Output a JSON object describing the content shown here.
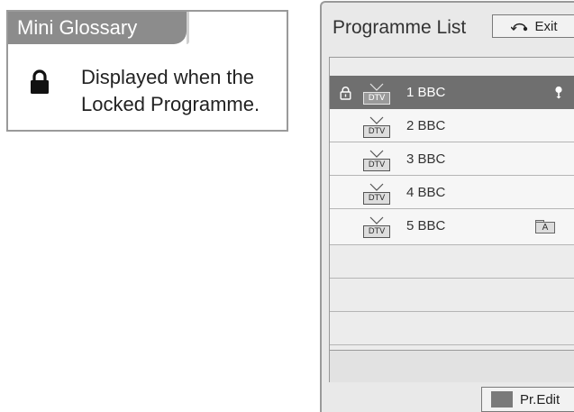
{
  "glossary": {
    "title": "Mini Glossary",
    "icon": "lock-icon",
    "line1": "Displayed when the",
    "line2": "Locked Programme."
  },
  "panel": {
    "title": "Programme List",
    "exit_label": "Exit",
    "footer_label": "Pr.Edit",
    "footer_color_key": "#7a7a7a",
    "selected_row_color": "#6f6f6f"
  },
  "programmes": [
    {
      "type": "DTV",
      "label": "1 BBC",
      "locked": true,
      "favourite": true,
      "selected": true
    },
    {
      "type": "DTV",
      "label": "2 BBC"
    },
    {
      "type": "DTV",
      "label": "3 BBC"
    },
    {
      "type": "DTV",
      "label": "4 BBC"
    },
    {
      "type": "DTV",
      "label": "5 BBC",
      "audio_badge": "A"
    }
  ]
}
